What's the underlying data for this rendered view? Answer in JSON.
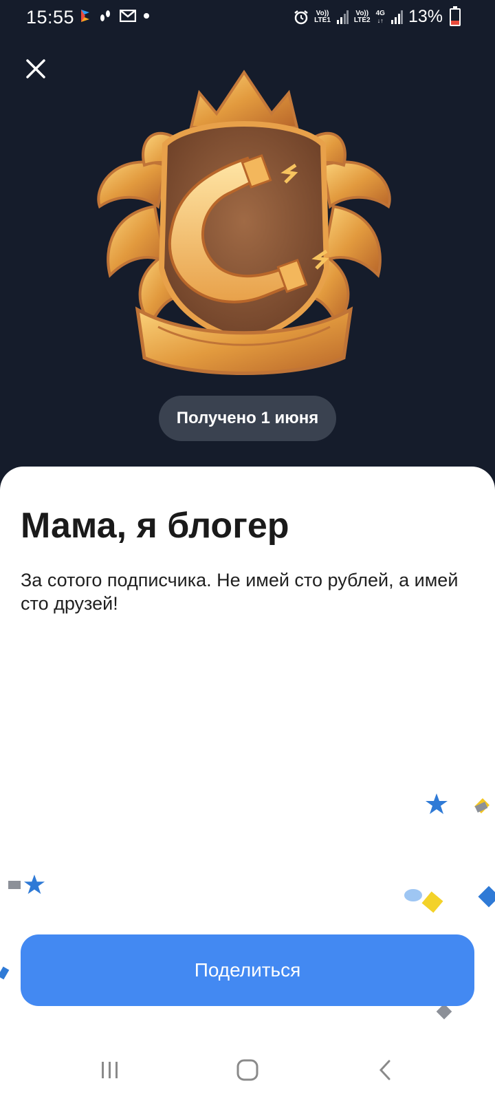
{
  "status_bar": {
    "time": "15:55",
    "sim1_label_top": "Vo))",
    "sim1_label_bottom": "LTE1",
    "sim2_label_top": "Vo))",
    "sim2_label_bottom": "LTE2",
    "network_type": "4G",
    "battery_percent": "13%",
    "icons": [
      "app-notification-icon",
      "steps-icon",
      "mail-icon",
      "dot-icon",
      "alarm-icon",
      "signal-icon",
      "battery-icon"
    ]
  },
  "header": {
    "close_icon": "close-icon"
  },
  "achievement": {
    "badge_icon": "golden-magnet-crest-icon",
    "date_label": "Получено 1 июня",
    "title": "Мама, я блогер",
    "description": "За сотого подписчика. Не имей сто рублей, а имей сто друзей!"
  },
  "actions": {
    "share_label": "Поделиться"
  },
  "nav_bar": {
    "icons": [
      "recent-apps-icon",
      "home-icon",
      "back-icon"
    ]
  },
  "colors": {
    "background": "#151c2b",
    "sheet": "#ffffff",
    "accent": "#4389f2",
    "pill": "#3a4250",
    "gold": "#e0a04a"
  }
}
